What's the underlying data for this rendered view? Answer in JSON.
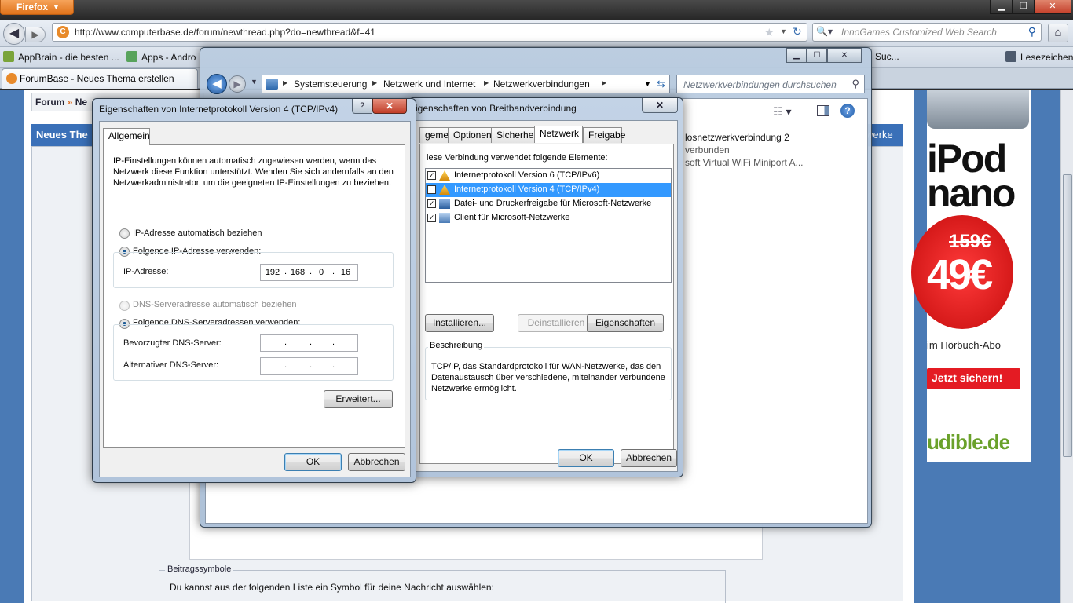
{
  "firefox": {
    "menu_label": "Firefox",
    "window_controls": {
      "minimize": "▁",
      "maximize": "❐",
      "close": "✕"
    },
    "url": "http://www.computerbase.de/forum/newthread.php?do=newthread&f=41",
    "search_placeholder": "InnoGames Customized Web Search",
    "bookmarks": [
      "AppBrain - die besten ...",
      "Apps - Andro",
      "Suc...",
      "Lesezeichen"
    ],
    "tab_title": "ForumBase - Neues Thema erstellen"
  },
  "webpage": {
    "breadcrumb_root": "Forum",
    "breadcrumb_sep": "»",
    "breadcrumb_current": "Ne",
    "section_title": "Neues The",
    "section_title_right": "werke",
    "symbols_legend": "Beitragssymbole",
    "symbols_text": "Du kannst aus der folgenden Liste ein Symbol für deine Nachricht auswählen:"
  },
  "ad": {
    "title": "iPod nano",
    "old_price": "159€",
    "price": "49€",
    "subtitle": "im Hörbuch-Abo",
    "cta": "Jetzt sichern!",
    "brand": "udible.de"
  },
  "explorer": {
    "breadcrumbs": [
      "Systemsteuerung",
      "Netzwerk und Internet",
      "Netzwerkverbindungen"
    ],
    "search_placeholder": "Netzwerkverbindungen durchsuchen",
    "connection_name": "losnetzwerkverbindung 2",
    "connection_status": "verbunden",
    "connection_device": "soft Virtual WiFi Miniport A..."
  },
  "dialog_broadband": {
    "title": "igenschaften von Breitbandverbindung",
    "tabs": [
      "gemein",
      "Optionen",
      "Sicherheit",
      "Netzwerk",
      "Freigabe"
    ],
    "active_tab": "Netzwerk",
    "connection_uses_label": "iese Verbindung verwendet folgende Elemente:",
    "items": [
      {
        "label": "Internetprotokoll Version 6 (TCP/IPv6)",
        "checked": true,
        "selected": false
      },
      {
        "label": "Internetprotokoll Version 4 (TCP/IPv4)",
        "checked": true,
        "selected": true
      },
      {
        "label": "Datei- und Druckerfreigabe für Microsoft-Netzwerke",
        "checked": true,
        "selected": false
      },
      {
        "label": "Client für Microsoft-Netzwerke",
        "checked": true,
        "selected": false
      }
    ],
    "install_button": "Installieren...",
    "uninstall_button": "Deinstallieren",
    "properties_button": "Eigenschaften",
    "description_legend": "Beschreibung",
    "description_text": "TCP/IP, das Standardprotokoll für WAN-Netzwerke, das den Datenaustausch über verschiedene, miteinander verbundene Netzwerke ermöglicht.",
    "ok_button": "OK",
    "cancel_button": "Abbrechen"
  },
  "dialog_ipv4": {
    "title": "Eigenschaften von Internetprotokoll Version 4 (TCP/IPv4)",
    "help_label": "?",
    "close_label": "✕",
    "tab": "Allgemein",
    "intro": "IP-Einstellungen können automatisch zugewiesen werden, wenn das Netzwerk diese Funktion unterstützt. Wenden Sie sich andernfalls an den Netzwerkadministrator, um die geeigneten IP-Einstellungen zu beziehen.",
    "radio_ip_auto": "IP-Adresse automatisch beziehen",
    "radio_ip_manual": "Folgende IP-Adresse verwenden:",
    "ip_label": "IP-Adresse:",
    "ip_octets": [
      "192",
      "168",
      "0",
      "16"
    ],
    "radio_dns_auto": "DNS-Serveradresse automatisch beziehen",
    "radio_dns_manual": "Folgende DNS-Serveradressen verwenden:",
    "dns_preferred_label": "Bevorzugter DNS-Server:",
    "dns_alternate_label": "Alternativer DNS-Server:",
    "advanced_button": "Erweitert...",
    "ok_button": "OK",
    "cancel_button": "Abbrechen"
  }
}
